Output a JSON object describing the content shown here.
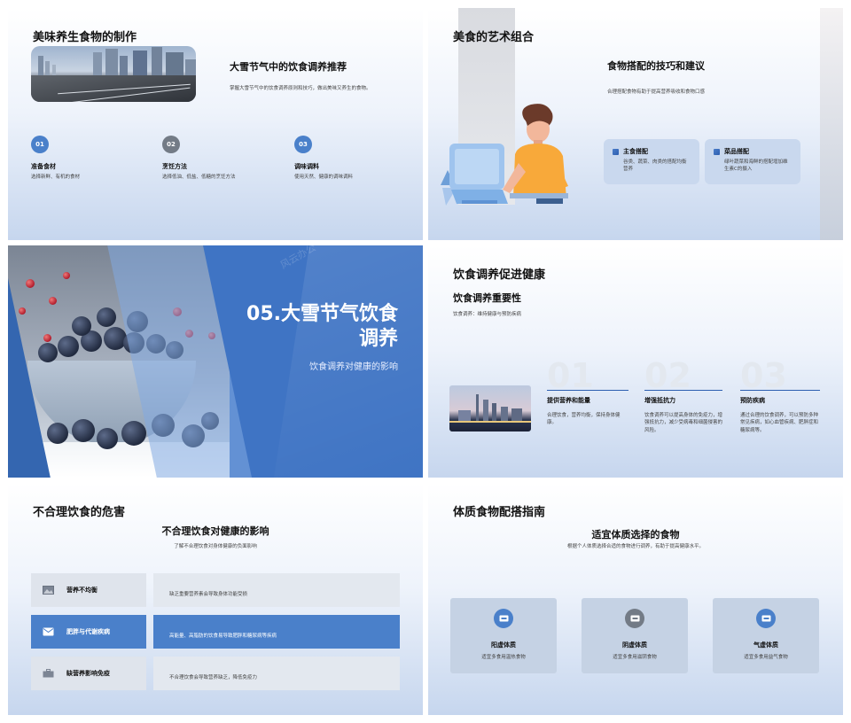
{
  "slide1": {
    "title": "美味养生食物的制作",
    "heading": "大雪节气中的饮食调养推荐",
    "desc": "掌握大雪节气中的饮食调养原则和技巧，做出美味又养生的食物。",
    "steps": [
      {
        "num": "01",
        "label": "准备食材",
        "desc": "选择新鲜、有机的食材",
        "color": "#4a80ca"
      },
      {
        "num": "02",
        "label": "烹饪方法",
        "desc": "选择低油、低盐、低糖的烹饪方法",
        "color": "#737b86"
      },
      {
        "num": "03",
        "label": "调味调料",
        "desc": "使用天然、健康的调味调料",
        "color": "#4a80ca"
      }
    ]
  },
  "slide2": {
    "title": "美食的艺术组合",
    "heading": "食物搭配的技巧和建议",
    "desc": "合理搭配食物有助于提高营养吸收和食物口感",
    "cards": [
      {
        "label": "主食搭配",
        "desc": "谷类、蔬菜、肉类的搭配均衡营养"
      },
      {
        "label": "菜品搭配",
        "desc": "绿叶蔬菜和海鲜的搭配增加维生素C的摄入"
      }
    ]
  },
  "slide3": {
    "title": "05.大雪节气饮食调养",
    "subtitle": "饮食调养对健康的影响",
    "watermark": "风云办公"
  },
  "slide4": {
    "title": "饮食调养促进健康",
    "heading": "饮食调养重要性",
    "desc": "饮食调养：维持健康与预防疾病",
    "items": [
      {
        "num": "01",
        "label": "提供营养和能量",
        "desc": "合理饮食，营养均衡，保持身体健康。"
      },
      {
        "num": "02",
        "label": "增强抵抗力",
        "desc": "饮食调养可以提高身体的免疫力，增强抵抗力，减少受病毒和细菌侵害的风险。"
      },
      {
        "num": "03",
        "label": "预防疾病",
        "desc": "通过合理的饮食调养，可以预防多种常见疾病，如心血管疾病、肥胖症和糖尿病等。"
      }
    ]
  },
  "slide5": {
    "title": "不合理饮食的危害",
    "heading": "不合理饮食对健康的影响",
    "desc": "了解不合理饮食对身体健康的负面影响",
    "rows": [
      {
        "label": "营养不均衡",
        "desc": "缺乏重要营养素会导致身体功能受损",
        "icon": "image-icon"
      },
      {
        "label": "肥胖与代谢疾病",
        "desc": "高能量、高脂肪的饮食易导致肥胖和糖尿病等疾病",
        "icon": "envelope-icon"
      },
      {
        "label": "缺营养影响免疫",
        "desc": "不合理饮食会导致营养缺乏，降低免疫力",
        "icon": "briefcase-icon"
      }
    ]
  },
  "slide6": {
    "title": "体质食物配搭指南",
    "heading": "适宜体质选择的食物",
    "desc": "根据个人体质选择合适的食物进行调养，有助于提高健康水平。",
    "cards": [
      {
        "label": "阳虚体质",
        "desc": "适宜多食用温热食物",
        "color": "#4a80ca"
      },
      {
        "label": "阴虚体质",
        "desc": "适宜多食用滋阴食物",
        "color": "#737b86"
      },
      {
        "label": "气虚体质",
        "desc": "适宜多食用益气食物",
        "color": "#4a80ca"
      }
    ]
  }
}
